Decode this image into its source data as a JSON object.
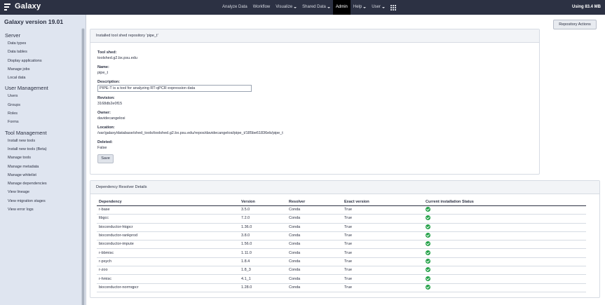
{
  "masthead": {
    "brand": "Galaxy",
    "nav": [
      {
        "label": "Analyze Data",
        "caret": false,
        "active": false
      },
      {
        "label": "Workflow",
        "caret": false,
        "active": false
      },
      {
        "label": "Visualize",
        "caret": true,
        "active": false
      },
      {
        "label": "Shared Data",
        "caret": true,
        "active": false
      },
      {
        "label": "Admin",
        "caret": false,
        "active": true
      },
      {
        "label": "Help",
        "caret": true,
        "active": false
      },
      {
        "label": "User",
        "caret": true,
        "active": false
      }
    ],
    "quota": "Using 83.4 MB"
  },
  "sidebar": {
    "title": "Galaxy version 19.01",
    "sections": [
      {
        "title": "Server",
        "items": [
          "Data types",
          "Data tables",
          "Display applications",
          "Manage jobs",
          "Local data"
        ]
      },
      {
        "title": "User Management",
        "items": [
          "Users",
          "Groups",
          "Roles",
          "Forms"
        ]
      },
      {
        "title": "Tool Management",
        "items": [
          "Install new tools",
          "Install new tools (Beta)",
          "Manage tools",
          "Manage metadata",
          "Manage whitelist",
          "Manage dependencies",
          "View lineage",
          "View migration stages",
          "View error logs"
        ]
      }
    ]
  },
  "repository_actions_label": "Repository Actions",
  "repo_card": {
    "header": "Installed tool shed repository 'pipe_t'",
    "tool_shed_label": "Tool shed:",
    "tool_shed": "toolshed.g2.bx.psu.edu",
    "name_label": "Name:",
    "name": "pipe_t",
    "description_label": "Description:",
    "description": "PIPE-T is a tool for analyzing RT-qPCR expression data",
    "revision_label": "Revision:",
    "revision": "3168db2e0f15",
    "owner_label": "Owner:",
    "owner": "davidecangelosi",
    "location_label": "Location:",
    "location": "/var/galaxy/database/shed_tools/toolshed.g2.bx.psu.edu/repos/davidecangelosi/pipe_t/185be61836eb/pipe_t",
    "deleted_label": "Deleted:",
    "deleted": "False",
    "save_label": "Save"
  },
  "dependencies": {
    "header": "Dependency Resolver Details",
    "columns": [
      "Dependency",
      "Version",
      "Resolver",
      "Exact version",
      "Current installation Status"
    ],
    "status_color": "#24a148",
    "rows": [
      {
        "dependency": "r-base",
        "version": "3.5.0",
        "resolver": "Conda",
        "exact": "True",
        "status_icon": "check-circle-icon"
      },
      {
        "dependency": "libgcc",
        "version": "7.2.0",
        "resolver": "Conda",
        "exact": "True",
        "status_icon": "check-circle-icon"
      },
      {
        "dependency": "bioconductor-htqpcr",
        "version": "1.36.0",
        "resolver": "Conda",
        "exact": "True",
        "status_icon": "check-circle-icon"
      },
      {
        "dependency": "bioconductor-rankprod",
        "version": "3.8.0",
        "resolver": "Conda",
        "exact": "True",
        "status_icon": "check-circle-icon"
      },
      {
        "dependency": "bioconductor-impute",
        "version": "1.56.0",
        "resolver": "Conda",
        "exact": "True",
        "status_icon": "check-circle-icon"
      },
      {
        "dependency": "r-bbmisc",
        "version": "1.11.0",
        "resolver": "Conda",
        "exact": "True",
        "status_icon": "check-circle-icon"
      },
      {
        "dependency": "r-psych",
        "version": "1.8.4",
        "resolver": "Conda",
        "exact": "True",
        "status_icon": "check-circle-icon"
      },
      {
        "dependency": "r-zoo",
        "version": "1.8_3",
        "resolver": "Conda",
        "exact": "True",
        "status_icon": "check-circle-icon"
      },
      {
        "dependency": "r-hmisc",
        "version": "4.1_1",
        "resolver": "Conda",
        "exact": "True",
        "status_icon": "check-circle-icon"
      },
      {
        "dependency": "bioconductor-normqpcr",
        "version": "1.28.0",
        "resolver": "Conda",
        "exact": "True",
        "status_icon": "check-circle-icon"
      }
    ]
  }
}
